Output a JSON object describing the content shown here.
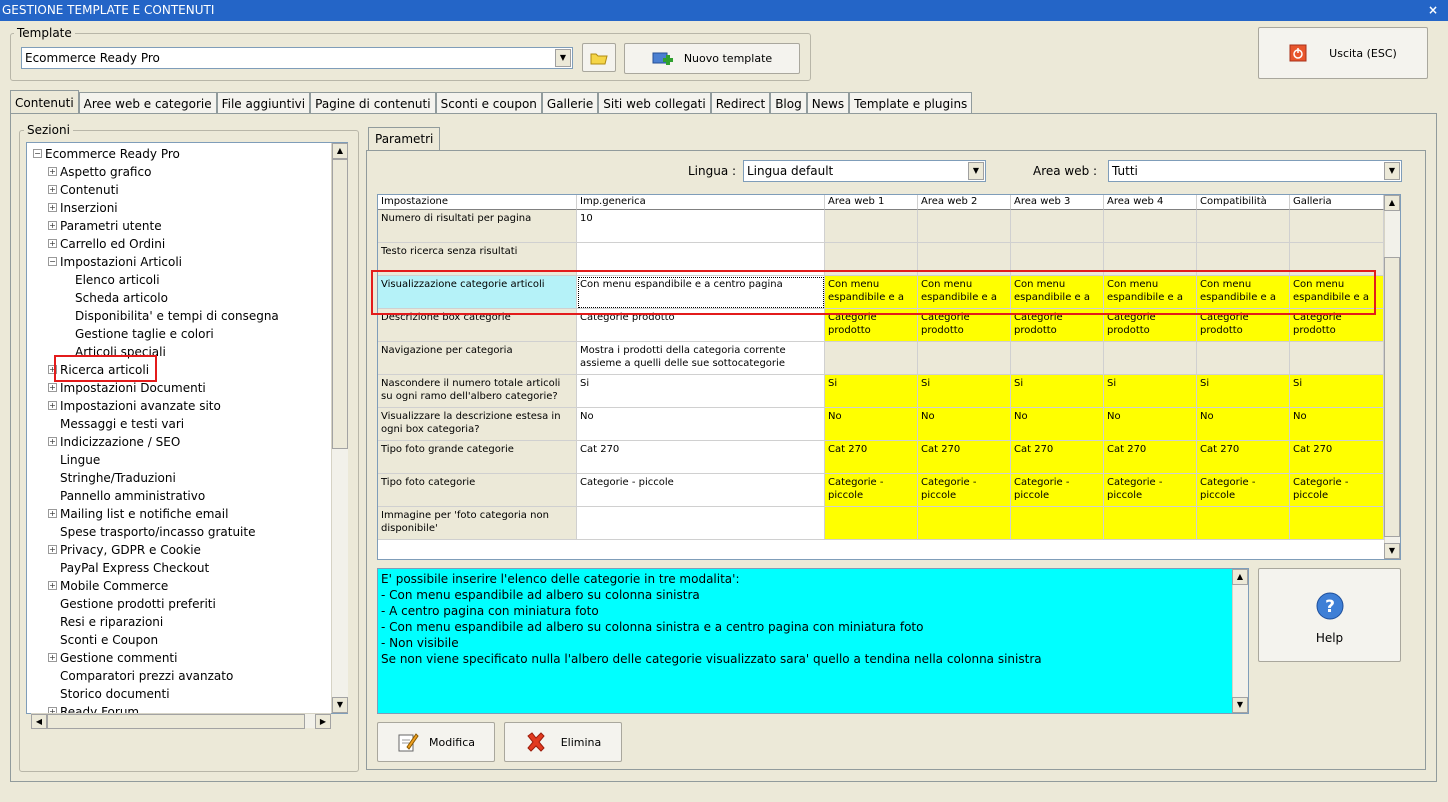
{
  "window": {
    "title": "GESTIONE TEMPLATE E CONTENUTI",
    "close": "×"
  },
  "template_group": {
    "label": "Template",
    "selected": "Ecommerce Ready Pro",
    "new_button": "Nuovo template"
  },
  "exit_button": "Uscita (ESC)",
  "tabs": [
    "Contenuti",
    "Aree web e categorie",
    "File aggiuntivi",
    "Pagine di contenuti",
    "Sconti e coupon",
    "Gallerie",
    "Siti web collegati",
    "Redirect",
    "Blog",
    "News",
    "Template e plugins"
  ],
  "sections": {
    "label": "Sezioni",
    "items": [
      {
        "label": "Ecommerce Ready Pro",
        "level": 0,
        "exp": "−"
      },
      {
        "label": "Aspetto grafico",
        "level": 1,
        "exp": "+"
      },
      {
        "label": "Contenuti",
        "level": 1,
        "exp": "+"
      },
      {
        "label": "Inserzioni",
        "level": 1,
        "exp": "+"
      },
      {
        "label": "Parametri utente",
        "level": 1,
        "exp": "+"
      },
      {
        "label": "Carrello ed Ordini",
        "level": 1,
        "exp": "+"
      },
      {
        "label": "Impostazioni Articoli",
        "level": 1,
        "exp": "−"
      },
      {
        "label": "Elenco articoli",
        "level": 2,
        "exp": ""
      },
      {
        "label": "Scheda articolo",
        "level": 2,
        "exp": ""
      },
      {
        "label": "Disponibilita' e tempi di consegna",
        "level": 2,
        "exp": ""
      },
      {
        "label": "Gestione taglie e colori",
        "level": 2,
        "exp": ""
      },
      {
        "label": "Articoli speciali",
        "level": 2,
        "exp": ""
      },
      {
        "label": "Ricerca articoli",
        "level": 1,
        "exp": "+"
      },
      {
        "label": "Impostazioni Documenti",
        "level": 1,
        "exp": "+"
      },
      {
        "label": "Impostazioni avanzate sito",
        "level": 1,
        "exp": "+"
      },
      {
        "label": "Messaggi e testi vari",
        "level": 1,
        "exp": ""
      },
      {
        "label": "Indicizzazione / SEO",
        "level": 1,
        "exp": "+"
      },
      {
        "label": "Lingue",
        "level": 1,
        "exp": ""
      },
      {
        "label": "Stringhe/Traduzioni",
        "level": 1,
        "exp": ""
      },
      {
        "label": "Pannello amministrativo",
        "level": 1,
        "exp": ""
      },
      {
        "label": "Mailing list e notifiche email",
        "level": 1,
        "exp": "+"
      },
      {
        "label": "Spese trasporto/incasso gratuite",
        "level": 1,
        "exp": ""
      },
      {
        "label": "Privacy, GDPR e Cookie",
        "level": 1,
        "exp": "+"
      },
      {
        "label": "PayPal Express Checkout",
        "level": 1,
        "exp": ""
      },
      {
        "label": "Mobile Commerce",
        "level": 1,
        "exp": "+"
      },
      {
        "label": "Gestione prodotti preferiti",
        "level": 1,
        "exp": ""
      },
      {
        "label": "Resi e riparazioni",
        "level": 1,
        "exp": ""
      },
      {
        "label": "Sconti e Coupon",
        "level": 1,
        "exp": ""
      },
      {
        "label": "Gestione commenti",
        "level": 1,
        "exp": "+"
      },
      {
        "label": "Comparatori prezzi avanzato",
        "level": 1,
        "exp": ""
      },
      {
        "label": "Storico documenti",
        "level": 1,
        "exp": ""
      },
      {
        "label": "Ready Forum",
        "level": 1,
        "exp": "+"
      }
    ]
  },
  "params_tab": "Parametri",
  "lingua": {
    "label": "Lingua :",
    "value": "Lingua default"
  },
  "area_web": {
    "label": "Area web :",
    "value": "Tutti"
  },
  "grid": {
    "columns": [
      "Impostazione",
      "Imp.generica",
      "Area web 1",
      "Area web 2",
      "Area web 3",
      "Area web 4",
      "Compatibilità",
      "Galleria"
    ],
    "rows": [
      {
        "name": "Numero di risultati per pagina",
        "generic": "10",
        "areas": [
          "",
          "",
          "",
          "",
          "",
          ""
        ],
        "yellow": false
      },
      {
        "name": "Testo ricerca senza risultati",
        "generic": "",
        "areas": [
          "",
          "",
          "",
          "",
          "",
          ""
        ],
        "yellow": false
      },
      {
        "name": "Visualizzazione categorie articoli",
        "generic": "Con menu espandibile e a centro pagina",
        "areas": [
          "Con menu espandibile e a ...",
          "Con menu espandibile e a ...",
          "Con menu espandibile e a ...",
          "Con menu espandibile e a ...",
          "Con menu espandibile e a ...",
          "Con menu espandibile e a ..."
        ],
        "yellow": true
      },
      {
        "name": "Descrizione box categorie",
        "generic": "Categorie prodotto",
        "areas": [
          "Categorie prodotto",
          "Categorie prodotto",
          "Categorie prodotto",
          "Categorie prodotto",
          "Categorie prodotto",
          "Categorie prodotto"
        ],
        "yellow": true
      },
      {
        "name": "Navigazione per categoria",
        "generic": "Mostra i prodotti della categoria corrente assieme a quelli delle sue sottocategorie",
        "areas": [
          "",
          "",
          "",
          "",
          "",
          ""
        ],
        "yellow": false
      },
      {
        "name": "Nascondere il numero totale articoli su ogni ramo dell'albero categorie?",
        "generic": "Si",
        "areas": [
          "Si",
          "Si",
          "Si",
          "Si",
          "Si",
          "Si"
        ],
        "yellow": true
      },
      {
        "name": "Visualizzare la descrizione estesa in ogni box categoria?",
        "generic": "No",
        "areas": [
          "No",
          "No",
          "No",
          "No",
          "No",
          "No"
        ],
        "yellow": true
      },
      {
        "name": "Tipo foto grande categorie",
        "generic": "Cat 270",
        "areas": [
          "Cat 270",
          "Cat 270",
          "Cat 270",
          "Cat 270",
          "Cat 270",
          "Cat 270"
        ],
        "yellow": true
      },
      {
        "name": "Tipo foto categorie",
        "generic": "Categorie - piccole",
        "areas": [
          "Categorie - piccole",
          "Categorie - piccole",
          "Categorie - piccole",
          "Categorie - piccole",
          "Categorie - piccole",
          "Categorie - piccole"
        ],
        "yellow": true
      },
      {
        "name": "Immagine per 'foto categoria non disponibile'",
        "generic": "",
        "areas": [
          "",
          "",
          "",
          "",
          "",
          ""
        ],
        "yellow": true
      }
    ]
  },
  "description": [
    "E' possibile inserire l'elenco delle categorie in tre modalita':",
    "- Con menu espandibile ad albero su colonna sinistra",
    "- A centro pagina con miniatura foto",
    "- Con menu espandibile ad albero su colonna sinistra e a centro pagina con miniatura foto",
    "- Non visibile",
    "Se non viene specificato nulla l'albero delle categorie visualizzato sara' quello a tendina nella colonna sinistra"
  ],
  "help_button": "Help",
  "modifica_button": "Modifica",
  "elimina_button": "Elimina",
  "colors": {
    "highlight_yellow": "#ffff00",
    "desc_bg": "#00ffff",
    "selected_cell": "#b5f2f8",
    "red_marker": "#e31b1b"
  }
}
